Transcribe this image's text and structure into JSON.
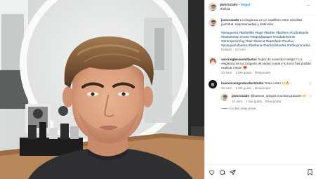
{
  "header": {
    "username": "javicruzado",
    "dot": "•",
    "follow_label": "Seguir",
    "subtitle": "Huelva",
    "more_label": "···"
  },
  "caption": {
    "username": "javicruzado",
    "text": "La elegancia es un equilibrio entre sencillez, pulcritud, espontaneidad y distinción.",
    "hashtags": "#peluqueria #barberlife #tupé #barber #barbero #cortedepelo #barbershop #corte #degradopaper #modabohemie #trimmgrooming #hair #haircut #taperfade #huelva #peluqueriahuelva #barberia #barberiahuelva #reflexpronudos",
    "time": "Editado · 10 sem"
  },
  "comments": [
    {
      "username": "auroraiglesiasmillastas",
      "text": "Super de acuerdo contigo !! La elegancia es un conjunto de varias cosas y tú no lo has podido explicar mejor! ❤️",
      "time": "10 sem",
      "likes": "1 Me gusta",
      "reply": "Responder"
    },
    {
      "username": "buenosamigosbarberstudio",
      "text": "Gran corte! 🙌🔥",
      "time": "10 sem",
      "likes": "1 Me gusta",
      "reply": "Responder"
    },
    {
      "username": "javicruzado",
      "text": "@buenos_amigos muchas gracias!! 🙌",
      "time": "10 sem",
      "likes": "1 Me gusta",
      "reply": "Responder"
    }
  ],
  "hide_replies": "Ocultar respuestas",
  "icons": [
    "heart-icon",
    "comment-icon",
    "share-icon",
    "bookmark-icon",
    "more-icon"
  ],
  "colors": {
    "link": "#00376b",
    "follow": "#0095f6",
    "text": "#262626",
    "muted": "#737373"
  }
}
